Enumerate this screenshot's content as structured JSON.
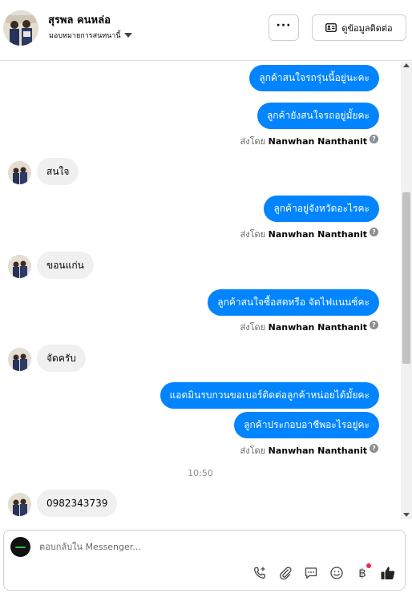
{
  "header": {
    "contact_name": "สุรพล คนหล่อ",
    "assign_label": "มอบหมายการสนทนานี้",
    "more_label": "···",
    "info_button_label": "ดูข้อมูลติดต่อ"
  },
  "conversation": {
    "messages": [
      {
        "from": "page",
        "text": "ลูกค้าสนใจรถรุ่นนี้อยู่นะคะ"
      },
      {
        "from": "page",
        "text": "ลูกค้ายังสนใจรถอยู่มั้ยคะ"
      },
      {
        "from": "customer",
        "text": "สนใจ"
      },
      {
        "from": "page",
        "text": "ลูกค้าอยู่จังหวัดอะไรคะ"
      },
      {
        "from": "customer",
        "text": "ขอนแก่น"
      },
      {
        "from": "page",
        "text": "ลูกค้าสนใจซื้อสดหรือ จัดไฟแนนซ์คะ"
      },
      {
        "from": "customer",
        "text": "จัดครับ"
      },
      {
        "from": "page",
        "text": "แอดมินรบกวนขอเบอร์ติดต่อลูกค้าหน่อยได้มั้ยคะ"
      },
      {
        "from": "page",
        "text": "ลูกค้าประกอบอาชีพอะไรอยู่คะ"
      },
      {
        "from": "customer",
        "text": "0982343739"
      }
    ],
    "sent_by_prefix": "ส่งโดย",
    "sent_by_name": "Nanwhan Nanthanit",
    "help_glyph": "?",
    "timestamp": "10:50"
  },
  "composer": {
    "placeholder": "ตอบกลับใน Messenger...",
    "tools": [
      "add-call-icon",
      "attachment-icon",
      "saved-reply-icon",
      "emoji-icon",
      "payment-icon",
      "like-icon"
    ],
    "payment_glyph": "฿"
  },
  "colors": {
    "outgoing_bubble": "#0084ff",
    "incoming_bubble": "#f0f0f0",
    "notification_dot": "#f0284a"
  }
}
